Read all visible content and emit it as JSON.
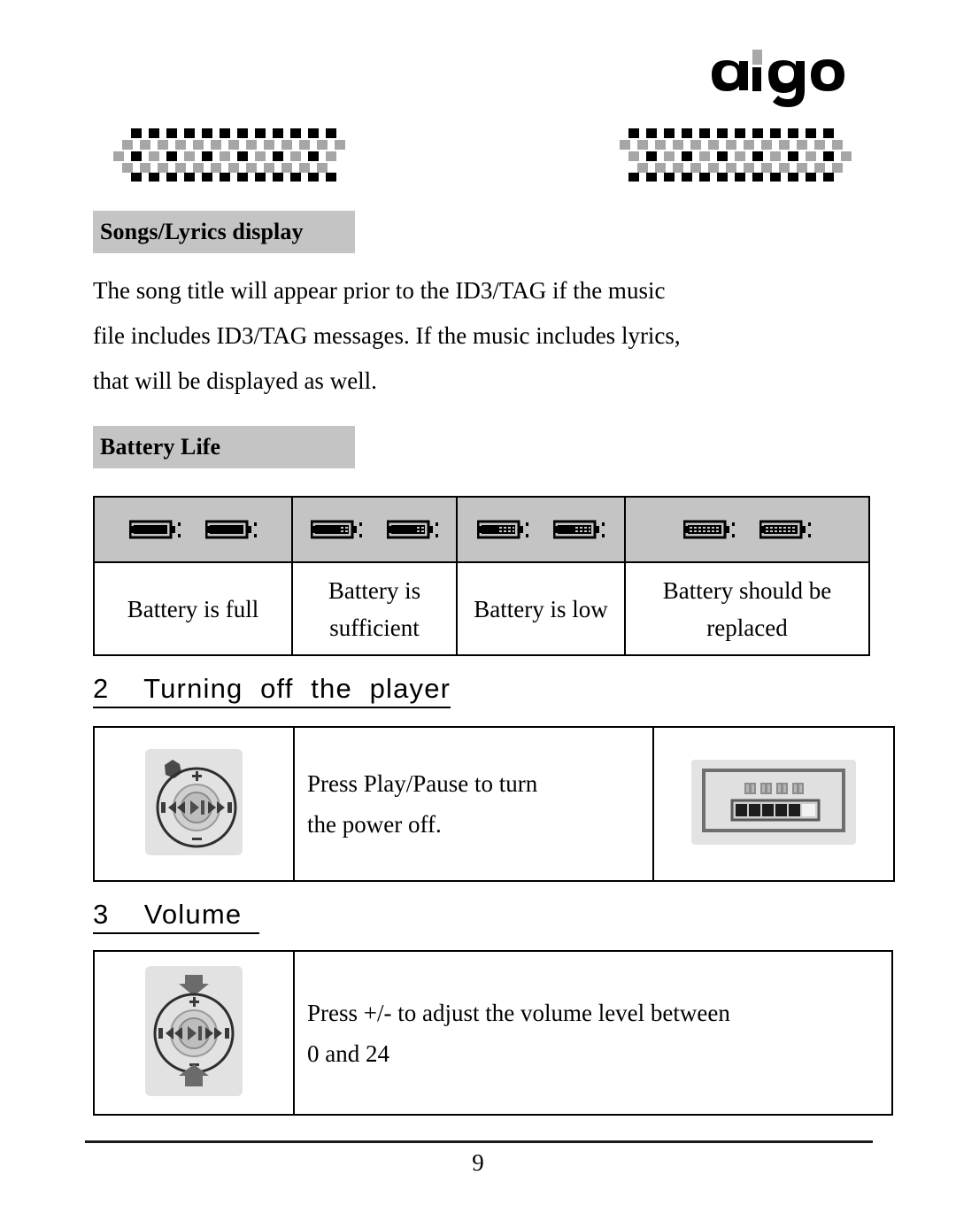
{
  "brand": {
    "logo_text": "aigo"
  },
  "decor": {
    "left_band": "checker-band",
    "right_band": "checker-band",
    "colors": {
      "dark": "#000000",
      "mid": "#a6a6a6",
      "light": "#ffffff"
    }
  },
  "sections": {
    "songs": {
      "heading": "Songs/Lyrics display",
      "paragraph_lines": [
        "The song title will appear prior to the ID3/TAG if the music",
        "file includes ID3/TAG messages. If the music includes lyrics,",
        "that will be displayed as well."
      ]
    },
    "battery": {
      "heading": "Battery Life",
      "table": {
        "columns": [
          {
            "label": "Battery is full",
            "icon": "battery-full-icon",
            "segments_filled": 4,
            "segments_total": 4
          },
          {
            "label": "Battery is sufficient",
            "icon": "battery-high-icon",
            "segments_filled": 3,
            "segments_total": 4
          },
          {
            "label": "Battery is low",
            "icon": "battery-low-icon",
            "segments_filled": 2,
            "segments_total": 4
          },
          {
            "label": "Battery should be replaced",
            "icon": "battery-empty-icon",
            "segments_filled": 0,
            "segments_total": 4
          }
        ]
      }
    },
    "turning_off": {
      "number": "2",
      "title": "Turning off the player",
      "heading_text": "2    Turning  off  the  player",
      "instruction_lines": [
        "Press Play/Pause to turn",
        "the power off."
      ],
      "control_icon": "control-pad-icon",
      "screen": {
        "icon": "lcd-screen-icon",
        "text": "关机中",
        "progress_filled": 5,
        "progress_total": 6
      }
    },
    "volume": {
      "number": "3",
      "title": "Volume",
      "heading_text": "3    Volume  ",
      "instruction_lines": [
        "Press +/- to adjust the volume level between",
        "0 and 24"
      ],
      "control_icon": "control-pad-updown-icon",
      "min_level": "0",
      "max_level": "24"
    }
  },
  "footer": {
    "page_number": "9"
  }
}
